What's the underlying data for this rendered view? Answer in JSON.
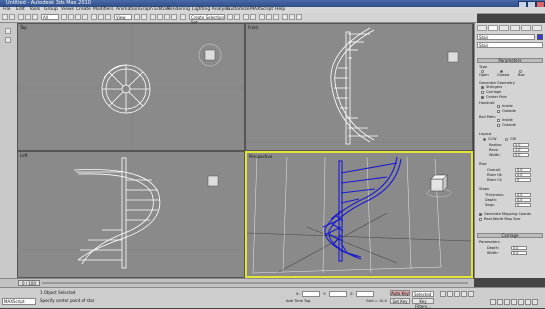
{
  "window": {
    "title": "Untitled - Autodesk 3ds Max 2010"
  },
  "menu": [
    "File",
    "Edit",
    "Tools",
    "Group",
    "Views",
    "Create",
    "Modifiers",
    "Animation",
    "Graph Editors",
    "Rendering",
    "Lighting Analysis",
    "Customize",
    "MAXScript",
    "Help"
  ],
  "toolbar": {
    "selection_filter": "All",
    "view_dropdown": "View",
    "named_selection": "Create Selection Set"
  },
  "viewports": [
    {
      "label": "Top"
    },
    {
      "label": "Front"
    },
    {
      "label": "Left"
    },
    {
      "label": "Perspective"
    }
  ],
  "command_panel": {
    "object_name": "Stair",
    "modifier_list": "Stair",
    "rollouts": {
      "parameters": "Parameters",
      "type_group": "Type",
      "type_options": [
        "Open",
        "Closed",
        "Box"
      ],
      "generate_geometry": "Generate Geometry",
      "generate_items": [
        "Stringers",
        "Carriage",
        "Center Pole"
      ],
      "handrail": "Handrail:",
      "handrail_opts": [
        "Inside",
        "Outside"
      ],
      "rail_path": "Rail Path:",
      "rail_path_opts": [
        "Inside",
        "Outside"
      ],
      "layout": "Layout",
      "layout_opts": [
        "CCW",
        "CW"
      ],
      "layout_fields": [
        {
          "label": "Radius:",
          "value": "0.0"
        },
        {
          "label": "Revs:",
          "value": "1.0"
        },
        {
          "label": "Width:",
          "value": "0.0"
        }
      ],
      "rise": "Rise",
      "rise_fields": [
        {
          "label": "Overall:",
          "value": "0.0"
        },
        {
          "label": "Riser Ht:",
          "value": "0.0"
        },
        {
          "label": "Riser Ct:",
          "value": "0"
        }
      ],
      "steps": "Steps",
      "steps_fields": [
        {
          "label": "Thickness:",
          "value": "0.0"
        },
        {
          "label": "Depth:",
          "value": "0.0"
        },
        {
          "label": "Segs:",
          "value": "0"
        }
      ],
      "gen_mapping": "Generate Mapping Coords",
      "real_world": "Real-World Map Size",
      "carriage": "Carriage",
      "carriage_params": "Parameters",
      "carriage_fields": [
        {
          "label": "Depth:",
          "value": "0.0"
        },
        {
          "label": "Width:",
          "value": "0.0"
        }
      ]
    }
  },
  "timeline": {
    "slider": "0 / 100"
  },
  "status": {
    "selected": "1 Object Selected",
    "prompt": "Specify center point of star",
    "maxscript": "MAXScript",
    "x_label": "X:",
    "y_label": "Y:",
    "z_label": "Z:",
    "grid": "Grid = 10.0",
    "auto_key": "Auto Key",
    "set_key": "Set Key",
    "key_filters": "Key Filters...",
    "selected_dropdown": "Selected",
    "add_time_tag": "Add Time Tag"
  }
}
